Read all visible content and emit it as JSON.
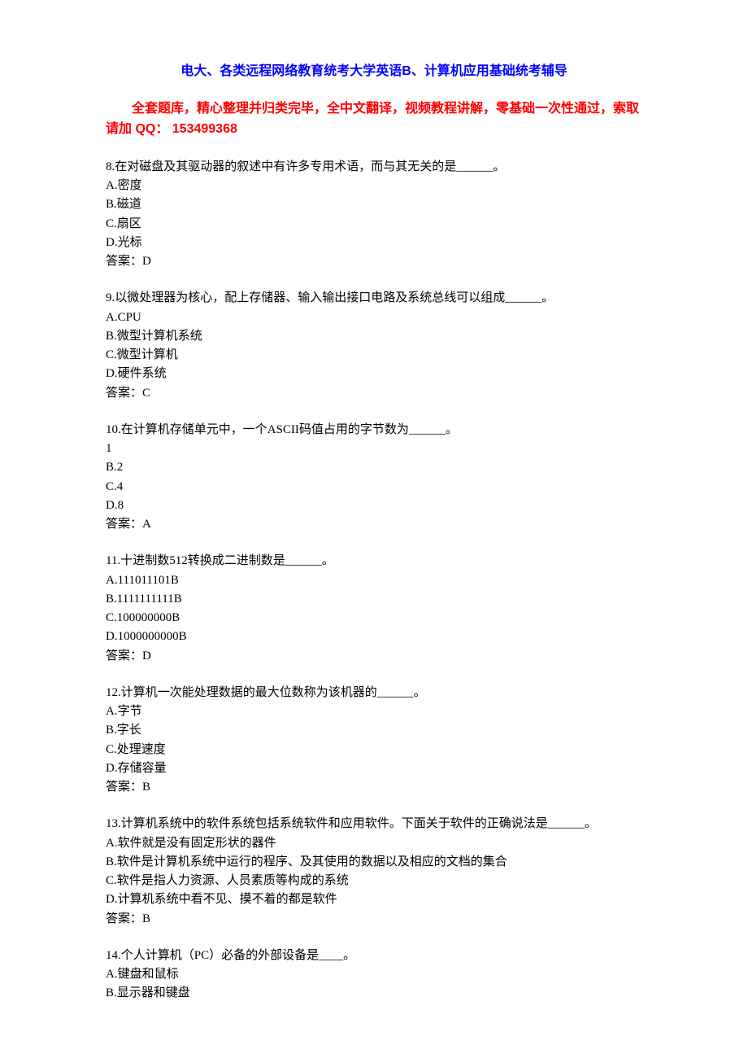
{
  "header": {
    "title": "电大、各类远程网络教育统考大学英语B、计算机应用基础统考辅导",
    "subtitle": "全套题库，精心整理并归类完毕，全中文翻译，视频教程讲解，零基础一次性通过，索取请加 QQ： 153499368"
  },
  "questions": [
    {
      "stem": "8.在对磁盘及其驱动器的叙述中有许多专用术语，而与其无关的是______。",
      "options": [
        "A.密度",
        "B.磁道",
        "C.扇区",
        "D.光标"
      ],
      "answer": "答案：D"
    },
    {
      "stem": "9.以微处理器为核心，配上存储器、输入输出接口电路及系统总线可以组成______。",
      "options": [
        "A.CPU",
        "B.微型计算机系统",
        "C.微型计算机",
        "D.硬件系统"
      ],
      "answer": "答案：C"
    },
    {
      "stem": "10.在计算机存储单元中，一个ASCII码值占用的字节数为______。",
      "options": [
        "1",
        "B.2",
        "C.4",
        "D.8"
      ],
      "answer": "答案：A"
    },
    {
      "stem": "11.十进制数512转换成二进制数是______。",
      "options": [
        "A.111011101B",
        "B.1111111111B",
        "C.100000000B",
        "D.1000000000B"
      ],
      "answer": "答案：D"
    },
    {
      "stem": "12.计算机一次能处理数据的最大位数称为该机器的______。",
      "options": [
        "A.字节",
        "B.字长",
        "C.处理速度",
        "D.存储容量"
      ],
      "answer": "答案：B"
    },
    {
      "stem": "13.计算机系统中的软件系统包括系统软件和应用软件。下面关于软件的正确说法是______。",
      "options": [
        "A.软件就是没有固定形状的器件",
        "B.软件是计算机系统中运行的程序、及其使用的数据以及相应的文档的集合",
        "C.软件是指人力资源、人员素质等构成的系统",
        "D.计算机系统中看不见、摸不着的都是软件"
      ],
      "answer": "答案：B"
    },
    {
      "stem": "14.个人计算机（PC）必备的外部设备是____。",
      "options": [
        "A.键盘和鼠标",
        "B.显示器和键盘"
      ],
      "answer": ""
    }
  ]
}
